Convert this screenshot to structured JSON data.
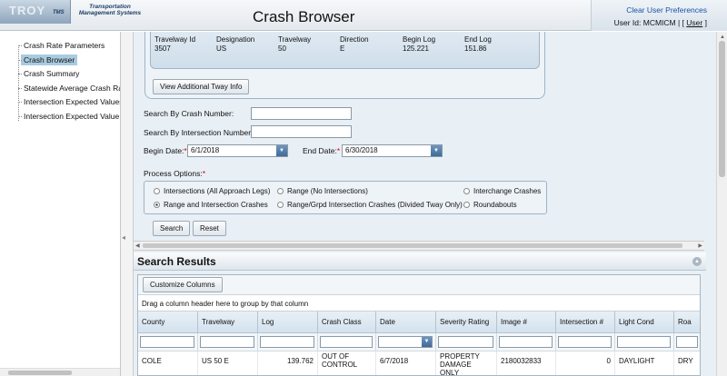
{
  "header": {
    "logo_text": "TROY",
    "logo_sub": "TMS",
    "tagline": "Transportation Management Systems",
    "title": "Crash Browser",
    "clear_prefs": "Clear User Preferences",
    "user_label": "User Id: MCMICM | [",
    "user_link": "User",
    "user_close": "]"
  },
  "sidebar": {
    "items": [
      {
        "label": "Crash Rate Parameters"
      },
      {
        "label": "Crash Browser"
      },
      {
        "label": "Crash Summary"
      },
      {
        "label": "Statewide Average Crash Rate"
      },
      {
        "label": "Intersection Expected Values"
      },
      {
        "label": "Intersection Expected Value D"
      }
    ]
  },
  "travelway": {
    "headers": [
      "Travelway Id",
      "Designation",
      "Travelway",
      "Direction",
      "Begin Log",
      "End Log"
    ],
    "values": [
      "3507",
      "US",
      "50",
      "E",
      "125.221",
      "151.86"
    ],
    "button": "View Additional Tway Info"
  },
  "form": {
    "crash_number_label": "Search By Crash Number:",
    "crash_number_value": "",
    "intersection_label": "Search By Intersection Number:",
    "intersection_value": "",
    "begin_date_label": "Begin Date:",
    "begin_date_value": "6/1/2018",
    "end_date_label": "End Date:",
    "end_date_value": "6/30/2018",
    "process_label": "Process Options:",
    "required_mark": "*",
    "options": [
      {
        "label": "Intersections (All Approach Legs)",
        "selected": false
      },
      {
        "label": "Range (No Intersections)",
        "selected": false
      },
      {
        "label": "Interchange Crashes",
        "selected": false
      },
      {
        "label": "Range and Intersection Crashes",
        "selected": true
      },
      {
        "label": "Range/Grpd Intersection Crashes (Divided Tway Only)",
        "selected": false
      },
      {
        "label": "Roundabouts",
        "selected": false
      }
    ],
    "search_button": "Search",
    "reset_button": "Reset"
  },
  "results": {
    "title": "Search Results",
    "customize_button": "Customize Columns",
    "group_hint": "Drag a column header here to group by that column",
    "columns": [
      "County",
      "Travelway",
      "Log",
      "Crash Class",
      "Date",
      "Severity Rating",
      "Image #",
      "Intersection #",
      "Light Cond",
      "Roa"
    ],
    "rows": [
      {
        "cells": [
          "COLE",
          "US 50 E",
          "139.762",
          "OUT OF\nCONTROL",
          "6/7/2018",
          "PROPERTY\nDAMAGE ONLY",
          "2180032833",
          "0",
          "DAYLIGHT",
          "DRY"
        ]
      }
    ]
  },
  "colors": {
    "accent": "#1a55a8",
    "panel": "#e8eff5",
    "nav_active": "#a9cbe0"
  }
}
